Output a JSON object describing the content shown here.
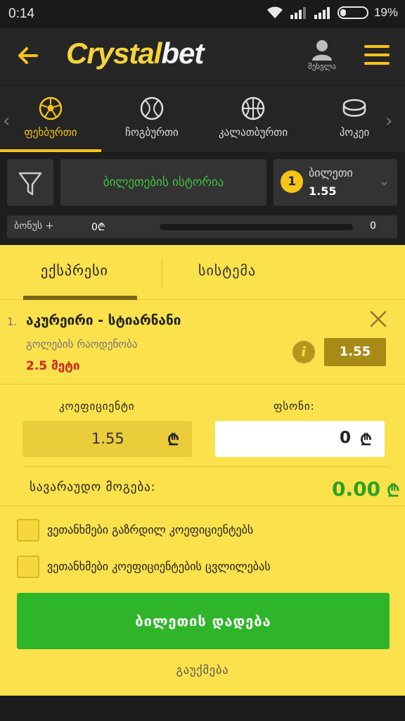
{
  "status": {
    "time": "0:14",
    "battery": "19%"
  },
  "header": {
    "logo_part1": "Crystal",
    "logo_part2": "bet",
    "login_label": "შესვლა"
  },
  "sports": [
    {
      "label": "ფეხბურთი",
      "icon": "soccer-ball-icon",
      "active": true
    },
    {
      "label": "ჩოგბურთი",
      "icon": "tennis-ball-icon",
      "active": false
    },
    {
      "label": "კალათბურთი",
      "icon": "basketball-icon",
      "active": false
    },
    {
      "label": "ჰოკეი",
      "icon": "hockey-puck-icon",
      "active": false
    }
  ],
  "ticketbar": {
    "history_label": "ბილეთების ისტორია",
    "ticket_count": "1",
    "ticket_label": "ბილეთი",
    "ticket_value": "1.55"
  },
  "bonus": {
    "label": "ბონუს +",
    "value": "0₾",
    "right_value": "0",
    "progress": 0
  },
  "betslip": {
    "tab_express": "ექსპრესი",
    "tab_system": "სისტემა",
    "bet": {
      "index": "1.",
      "match": "აკურეირი - სტიარნანი",
      "market": "გოლების რაოდენობა",
      "pick": "2.5 მეტი",
      "odd": "1.55"
    },
    "coef_label": "კოეფიციენტი",
    "stake_label": "ფსონი:",
    "coef_value": "1.55",
    "stake_value": "0",
    "currency": "₾",
    "win_label": "სავარაუდო მოგება:",
    "win_value": "0.00",
    "option1": "ვეთანხმები გაზრდილ კოეფიციენტებს",
    "option2": "ვეთანხმები კოეფიციენტების ცვლილებას",
    "place_button": "ბილეთის დადება",
    "cancel": "გაუქმება"
  },
  "colors": {
    "accent": "#f5c518",
    "panel": "#fbe14c",
    "green": "#2fb529",
    "red": "#d02020"
  }
}
